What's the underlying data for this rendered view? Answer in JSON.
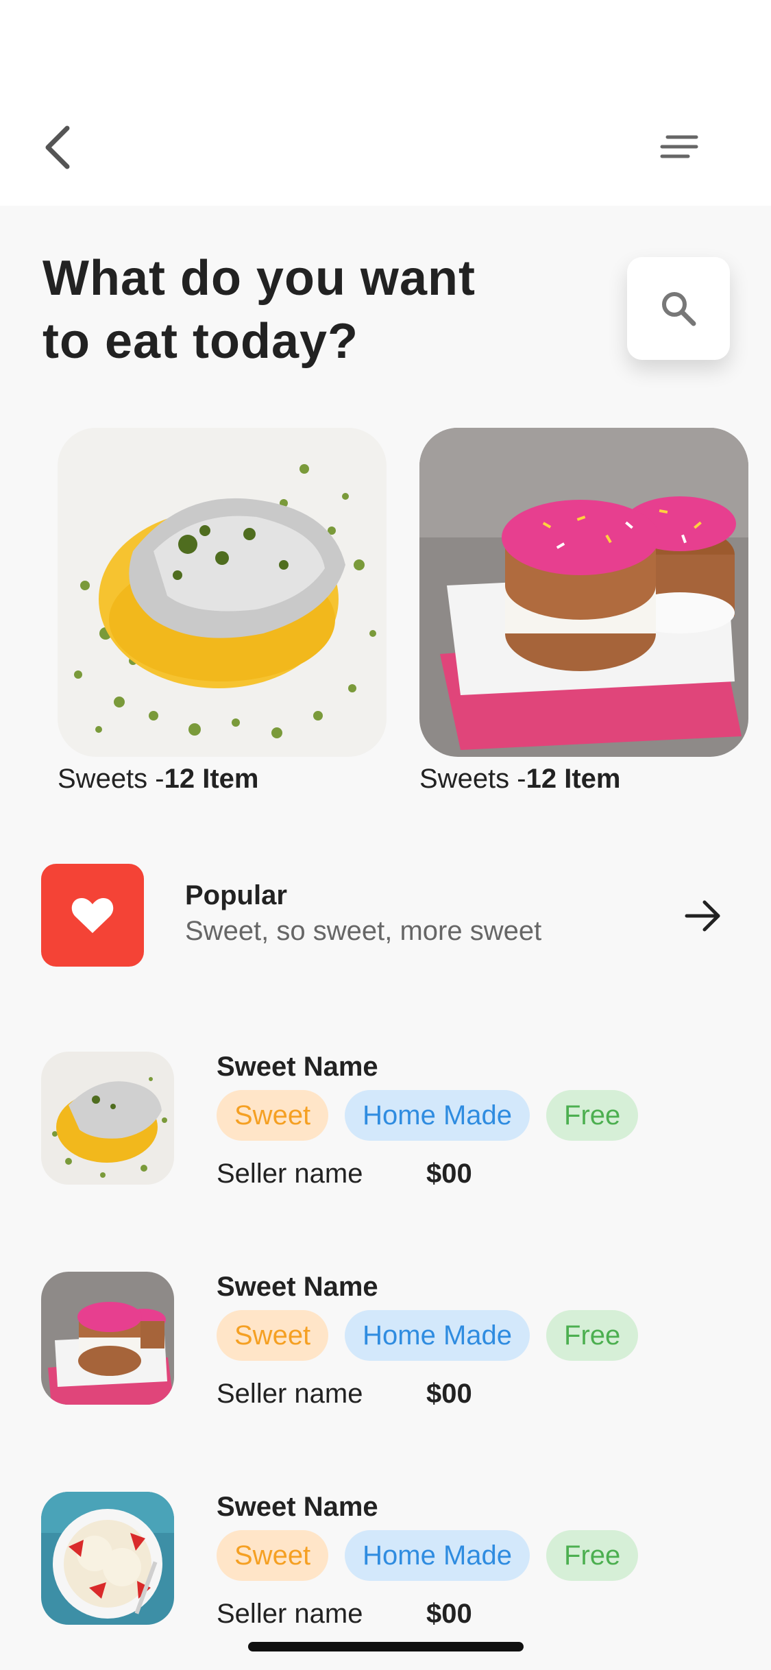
{
  "header": {
    "back_icon": "chevron-left-icon",
    "menu_icon": "sort-lines-icon",
    "title_line1": "What do you want",
    "title_line2": "to eat today?",
    "search_icon": "search-icon"
  },
  "categories": [
    {
      "label": "Sweets -",
      "count": "12 Item",
      "image": "barfi-with-silver-leaf"
    },
    {
      "label": "Sweets -",
      "count": "12 Item",
      "image": "pink-sprinkled-donuts"
    }
  ],
  "popular": {
    "icon": "heart-icon",
    "title": "Popular",
    "subtitle": "Sweet, so sweet, more sweet",
    "arrow_icon": "arrow-right-icon"
  },
  "items": [
    {
      "name": "Sweet Name",
      "tags": [
        "Sweet",
        "Home Made",
        "Free"
      ],
      "seller": "Seller name",
      "price": "$00",
      "image": "barfi"
    },
    {
      "name": "Sweet Name",
      "tags": [
        "Sweet",
        "Home Made",
        "Free"
      ],
      "seller": "Seller name",
      "price": "$00",
      "image": "donuts"
    },
    {
      "name": "Sweet Name",
      "tags": [
        "Sweet",
        "Home Made",
        "Free"
      ],
      "seller": "Seller name",
      "price": "$00",
      "image": "ice-cream-strawberries"
    }
  ],
  "colors": {
    "accent_red": "#f44336",
    "tag_sweet": "#f5a023",
    "tag_home": "#2f8ce0",
    "tag_free": "#4caf50"
  }
}
